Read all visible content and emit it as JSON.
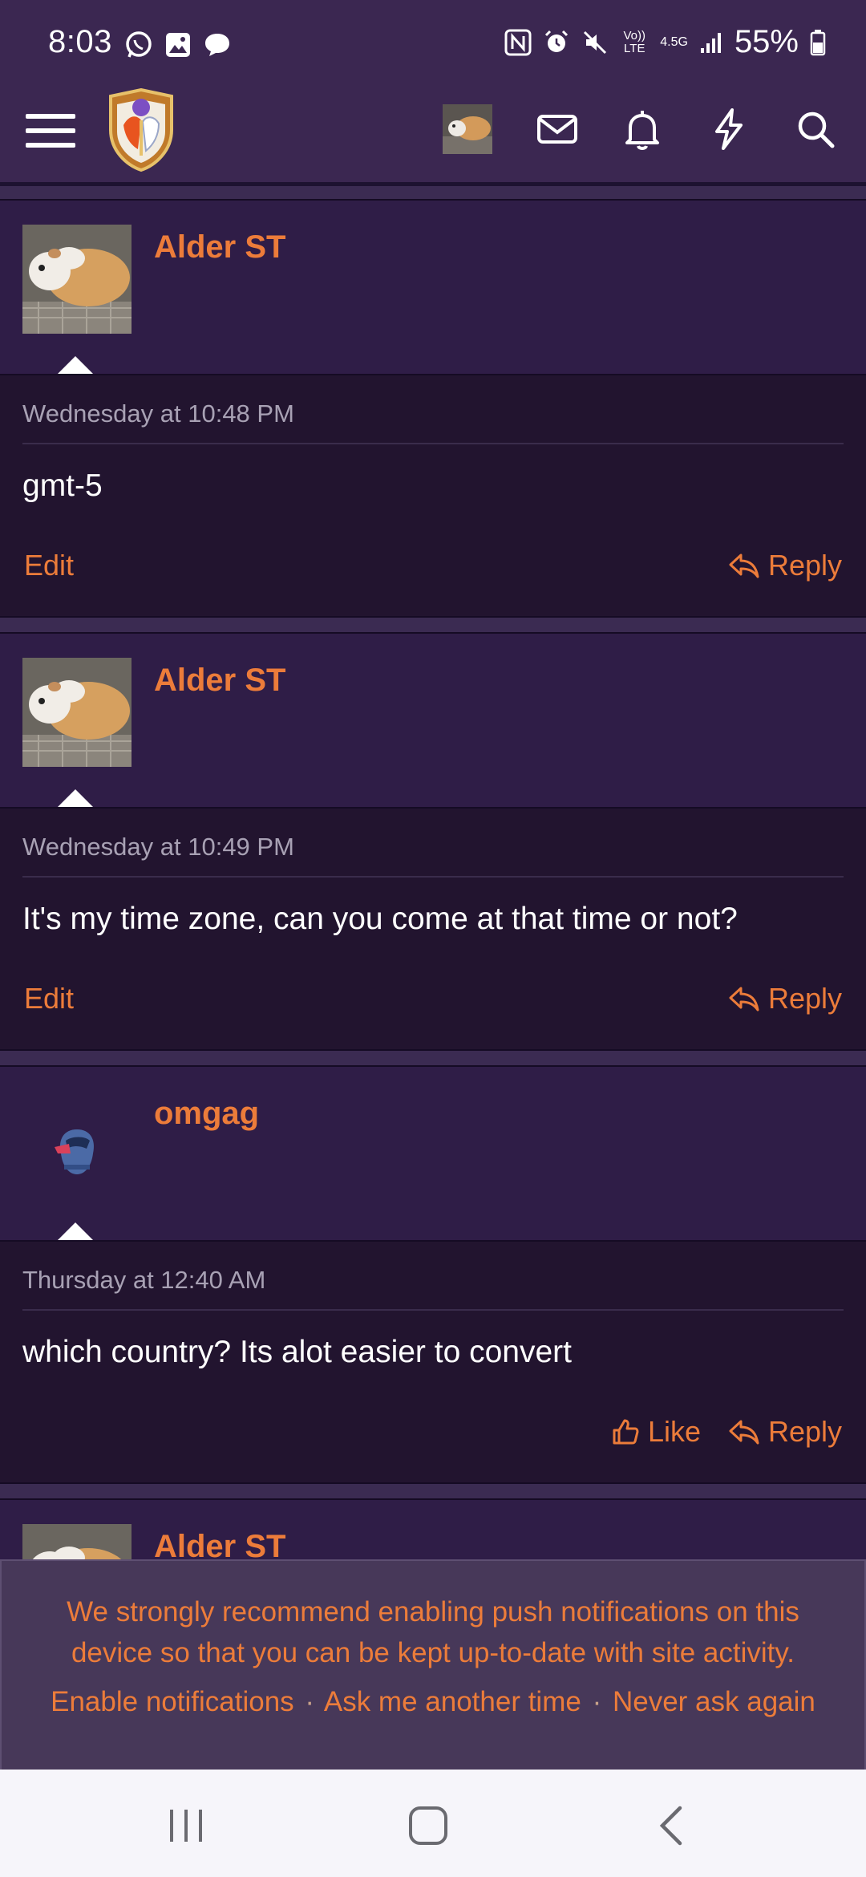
{
  "status_bar": {
    "time": "8:03",
    "network": "Vo)) LTE",
    "network_gen": "4.5G",
    "battery_percent": "55%"
  },
  "header": {
    "icons": [
      "menu-icon",
      "site-logo",
      "user-avatar",
      "mail-icon",
      "bell-icon",
      "lightning-icon",
      "search-icon"
    ]
  },
  "posts": [
    {
      "username": "Alder ST",
      "timestamp": "Wednesday at 10:48 PM",
      "text": "gmt-5",
      "left_action": "Edit",
      "reply": "Reply"
    },
    {
      "username": "Alder ST",
      "timestamp": "Wednesday at 10:49 PM",
      "text": "It's my time zone, can you come at that time or not?",
      "left_action": "Edit",
      "reply": "Reply"
    },
    {
      "username": "omgag",
      "timestamp": "Thursday at 12:40 AM",
      "text": "which country? Its alot easier to convert",
      "like": "Like",
      "reply": "Reply"
    },
    {
      "username": "Alder ST"
    }
  ],
  "notice": {
    "message": "We strongly recommend enabling push notifications on this device so that you can be kept up-to-date with site activity.",
    "enable": "Enable notifications",
    "later": "Ask me another time",
    "never": "Never ask again",
    "separator": "·"
  },
  "colors": {
    "accent": "#ec7c3a",
    "header_bg": "#3b2751",
    "post_user_bg": "#2f1d47",
    "post_body_bg": "#22142f",
    "notice_bg": "#473859"
  }
}
